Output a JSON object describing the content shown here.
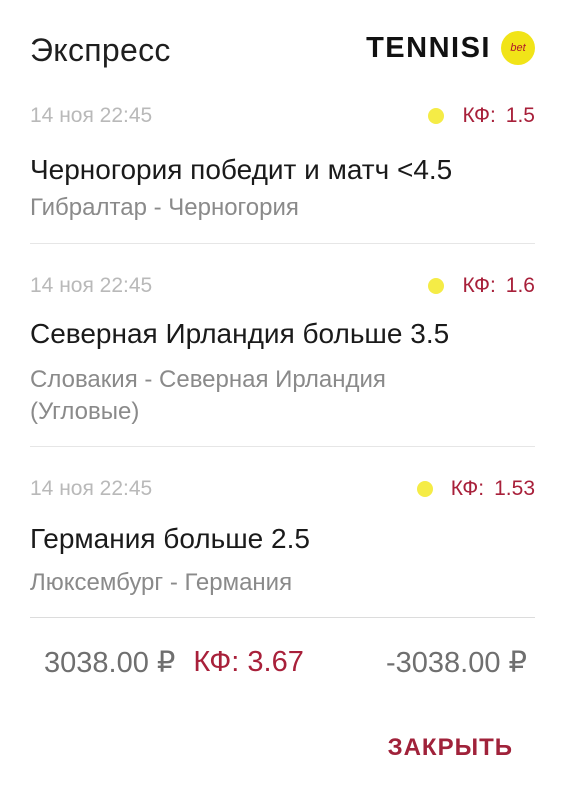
{
  "header": {
    "title": "Экспресс",
    "brand": "TENNISI",
    "brand_badge": "bet"
  },
  "bets": [
    {
      "date": "14 ноя 22:45",
      "odds_label": "КФ:",
      "odds_value": "1.5",
      "selection": "Черногория победит и матч <4.5",
      "match": "Гибралтар - Черногория"
    },
    {
      "date": "14 ноя 22:45",
      "odds_label": "КФ:",
      "odds_value": "1.6",
      "selection": "Северная Ирландия больше 3.5",
      "match": "Словакия - Северная Ирландия (Угловые)"
    },
    {
      "date": "14 ноя 22:45",
      "odds_label": "КФ:",
      "odds_value": "1.53",
      "selection": "Германия больше 2.5",
      "match": "Люксембург - Германия"
    }
  ],
  "totals": {
    "stake": "3038.00 ₽",
    "total_odds": "КФ: 3.67",
    "payout": "-3038.00 ₽"
  },
  "actions": {
    "close_label": "ЗАКРЫТЬ"
  },
  "colors": {
    "accent": "#a8203a",
    "status_dot": "#f5ec46",
    "brand_badge": "#f1e418"
  }
}
